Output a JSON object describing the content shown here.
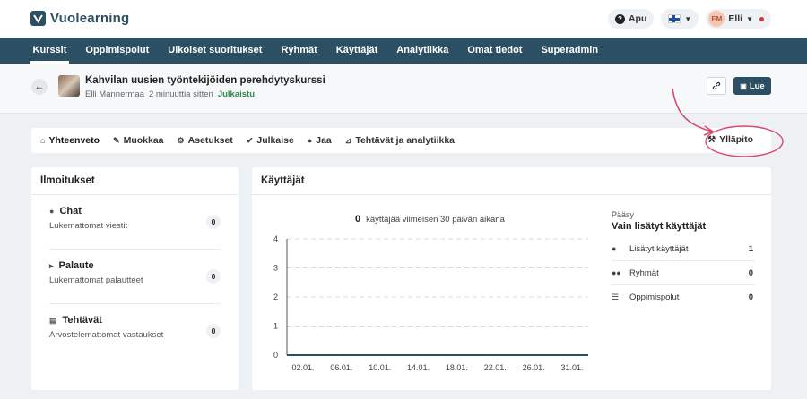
{
  "brand": {
    "name": "Vuolearning",
    "color": "#2d4f63"
  },
  "topbar": {
    "help_label": "Apu",
    "language_icon": "finnish-flag-icon",
    "user": {
      "initials": "EM",
      "name": "Elli"
    }
  },
  "nav": {
    "items": [
      {
        "label": "Kurssit",
        "active": true
      },
      {
        "label": "Oppimispolut"
      },
      {
        "label": "Ulkoiset suoritukset"
      },
      {
        "label": "Ryhmät"
      },
      {
        "label": "Käyttäjät"
      },
      {
        "label": "Analytiikka"
      },
      {
        "label": "Omat tiedot"
      },
      {
        "label": "Superadmin"
      }
    ]
  },
  "course": {
    "title": "Kahvilan uusien työntekijöiden perehdytyskurssi",
    "author": "Elli Mannermaa",
    "updated": "2 minuuttia sitten",
    "status": "Julkaistu",
    "read_label": "Lue"
  },
  "tabs": {
    "items": [
      {
        "label": "Yhteenveto",
        "icon": "home-icon"
      },
      {
        "label": "Muokkaa",
        "icon": "pencil-icon"
      },
      {
        "label": "Asetukset",
        "icon": "gear-icon"
      },
      {
        "label": "Julkaise",
        "icon": "check-circle-icon"
      },
      {
        "label": "Jaa",
        "icon": "person-icon"
      },
      {
        "label": "Tehtävät ja analytiikka",
        "icon": "chart-icon"
      }
    ],
    "maintenance_label": "Ylläpito"
  },
  "notifications": {
    "title": "Ilmoitukset",
    "items": [
      {
        "title": "Chat",
        "subtitle": "Lukemattomat viestit",
        "count": "0",
        "icon": "chat-icon"
      },
      {
        "title": "Palaute",
        "subtitle": "Lukemattomat palautteet",
        "count": "0",
        "icon": "megaphone-icon"
      },
      {
        "title": "Tehtävät",
        "subtitle": "Arvostelemattomat vastaukset",
        "count": "0",
        "icon": "list-icon"
      }
    ]
  },
  "users": {
    "title": "Käyttäjät",
    "summary_count": "0",
    "summary_text": "käyttäjää viimeisen 30 päivän aikana",
    "access_label": "Pääsy",
    "access_value": "Vain lisätyt käyttäjät",
    "stats": [
      {
        "label": "Lisätyt käyttäjät",
        "value": "1",
        "icon": "user-icon"
      },
      {
        "label": "Ryhmät",
        "value": "0",
        "icon": "users-icon"
      },
      {
        "label": "Oppimispolut",
        "value": "0",
        "icon": "list-icon"
      }
    ]
  },
  "chart_data": {
    "type": "line",
    "x": [
      "02.01.",
      "06.01.",
      "10.01.",
      "14.01.",
      "18.01.",
      "22.01.",
      "26.01.",
      "31.01."
    ],
    "ylim": [
      0,
      4
    ],
    "yticks": [
      "0",
      "1",
      "2",
      "3",
      "4"
    ],
    "grid": true,
    "series": [
      {
        "values": [
          0,
          0,
          0,
          0,
          0,
          0,
          0,
          0
        ],
        "color": "#2d4f63"
      }
    ]
  }
}
